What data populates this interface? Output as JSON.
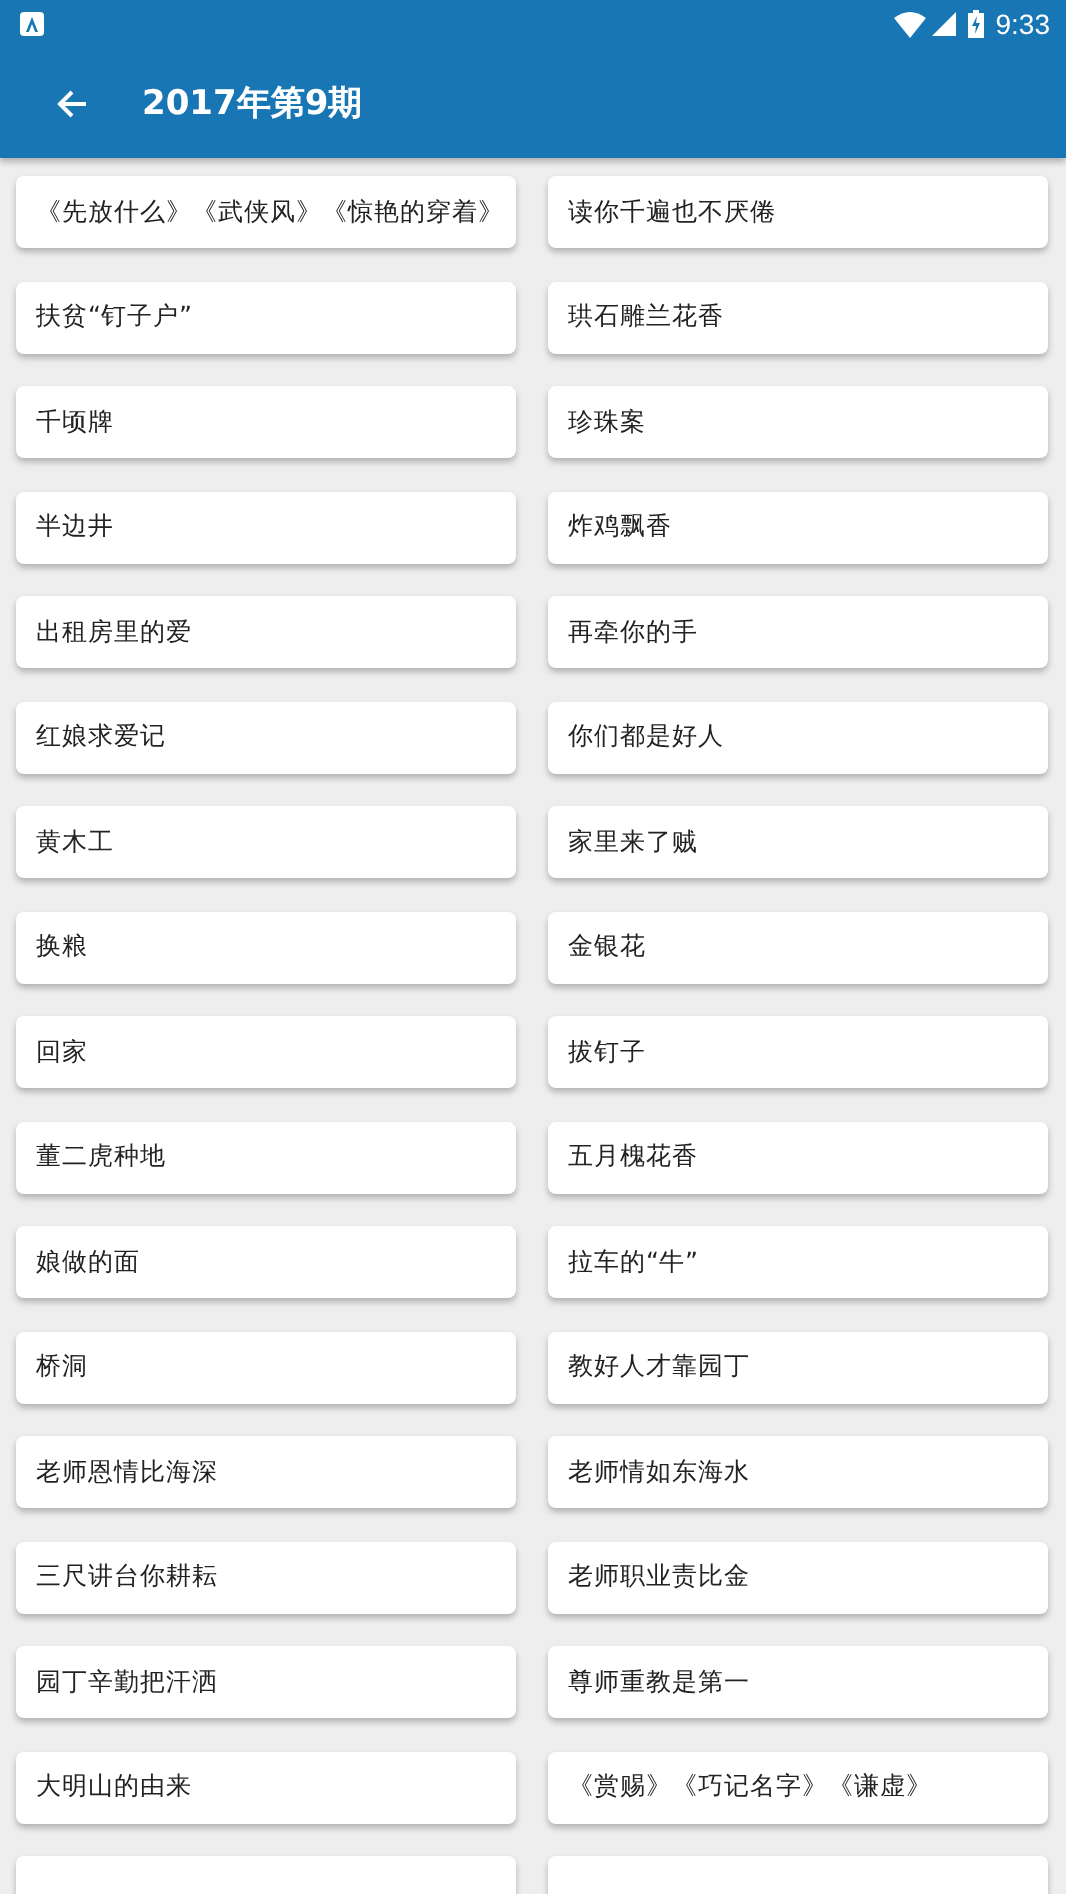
{
  "status_bar": {
    "time": "9:33"
  },
  "app_bar": {
    "title": "2017年第9期"
  },
  "articles": [
    {
      "title": "《先放什么》《武侠风》《惊艳的穿着》"
    },
    {
      "title": "读你千遍也不厌倦"
    },
    {
      "title": "扶贫“钉子户”"
    },
    {
      "title": "珙石雕兰花香"
    },
    {
      "title": "千顷牌"
    },
    {
      "title": "珍珠案"
    },
    {
      "title": "半边井"
    },
    {
      "title": "炸鸡飘香"
    },
    {
      "title": "出租房里的爱"
    },
    {
      "title": "再牵你的手"
    },
    {
      "title": "红娘求爱记"
    },
    {
      "title": "你们都是好人"
    },
    {
      "title": "黄木工"
    },
    {
      "title": "家里来了贼"
    },
    {
      "title": "换粮"
    },
    {
      "title": "金银花"
    },
    {
      "title": "回家"
    },
    {
      "title": "拔钉子"
    },
    {
      "title": "董二虎种地"
    },
    {
      "title": "五月槐花香"
    },
    {
      "title": "娘做的面"
    },
    {
      "title": "拉车的“牛”"
    },
    {
      "title": "桥洞"
    },
    {
      "title": "教好人才靠园丁"
    },
    {
      "title": "老师恩情比海深"
    },
    {
      "title": "老师情如东海水"
    },
    {
      "title": "三尺讲台你耕耘"
    },
    {
      "title": "老师职业责比金"
    },
    {
      "title": "园丁辛勤把汗洒"
    },
    {
      "title": "尊师重教是第一"
    },
    {
      "title": "大明山的由来"
    },
    {
      "title": "《赏赐》《巧记名字》《谦虚》"
    }
  ]
}
